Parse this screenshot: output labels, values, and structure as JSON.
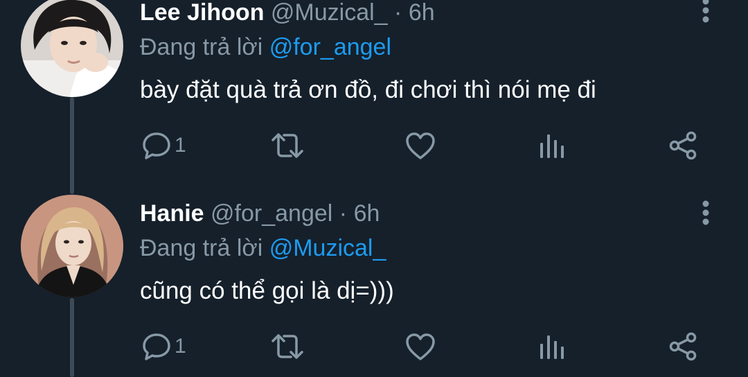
{
  "tweets": [
    {
      "display_name": "Lee Jihoon",
      "handle": "@Muzical_",
      "separator": "·",
      "time": "6h",
      "replying_prefix": "Đang trả lời",
      "replying_to": "@for_angel",
      "text": "bày đặt quà trả ơn đồ, đi chơi thì nói mẹ đi",
      "reply_count": "1"
    },
    {
      "display_name": "Hanie",
      "handle": "@for_angel",
      "separator": "·",
      "time": "6h",
      "replying_prefix": "Đang trả lời",
      "replying_to": "@Muzical_",
      "text": "cũng có thể gọi là dị=)))",
      "reply_count": "1"
    }
  ],
  "icons": {
    "more": "more-vertical-icon",
    "reply": "reply-bubble-icon",
    "retweet": "retweet-icon",
    "like": "heart-icon",
    "stats": "analytics-icon",
    "share": "share-icon"
  },
  "colors": {
    "background": "#15202b",
    "text": "#ffffff",
    "secondary": "#8899a6",
    "accent": "#1d9bf0",
    "thread_line": "#3d4a57"
  }
}
